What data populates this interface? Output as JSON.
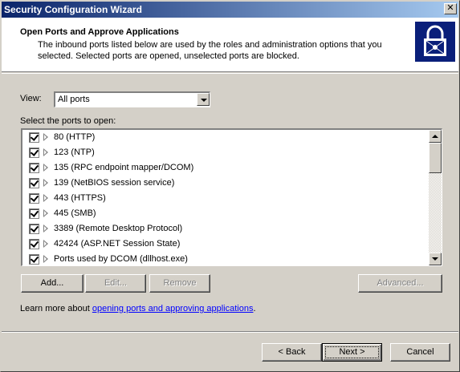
{
  "window": {
    "title": "Security Configuration Wizard"
  },
  "header": {
    "title": "Open Ports and Approve Applications",
    "description": "The inbound ports listed below are used by the roles and administration options that you selected. Selected ports are opened, unselected ports are blocked."
  },
  "view": {
    "label": "View:",
    "selected": "All ports"
  },
  "ports": {
    "label": "Select the ports to open:",
    "items": [
      {
        "label": "80 (HTTP)",
        "checked": true
      },
      {
        "label": "123 (NTP)",
        "checked": true
      },
      {
        "label": "135 (RPC endpoint mapper/DCOM)",
        "checked": true
      },
      {
        "label": "139 (NetBIOS session service)",
        "checked": true
      },
      {
        "label": "443 (HTTPS)",
        "checked": true
      },
      {
        "label": "445 (SMB)",
        "checked": true
      },
      {
        "label": "3389 (Remote Desktop Protocol)",
        "checked": true
      },
      {
        "label": "42424 (ASP.NET Session State)",
        "checked": true
      },
      {
        "label": "Ports used by DCOM (dllhost.exe)",
        "checked": true
      }
    ]
  },
  "actions": {
    "add": "Add...",
    "edit": "Edit...",
    "remove": "Remove",
    "advanced": "Advanced..."
  },
  "learn_more": {
    "prefix": "Learn more about ",
    "link": "opening ports and approving applications",
    "suffix": "."
  },
  "footer": {
    "back": "< Back",
    "next": "Next >",
    "cancel": "Cancel"
  }
}
